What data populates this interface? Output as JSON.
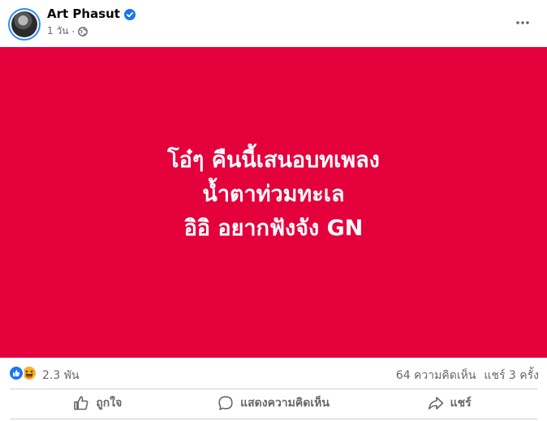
{
  "post": {
    "author": "Art Phasut",
    "time": "1 วัน",
    "separator": "·",
    "content_lines": [
      "โอ๋ๆ คืนนี้เสนอบทเพลง",
      "น้ำตาท่วมทะเล",
      "อิอิ อยากฟังจัง GN"
    ],
    "background_color": "#e4003b"
  },
  "stats": {
    "reaction_count": "2.3 พัน",
    "comments": "64 ความคิดเห็น",
    "shares": "แชร์ 3 ครั้ง",
    "reaction_types": [
      "like",
      "haha"
    ]
  },
  "actions": {
    "like_label": "ถูกใจ",
    "comment_label": "แสดงความคิดเห็น",
    "share_label": "แชร์"
  },
  "icons": [
    "verified-badge-icon",
    "globe-icon",
    "more-options-icon",
    "like-reaction-icon",
    "haha-reaction-icon",
    "thumbs-up-icon",
    "comment-bubble-icon",
    "share-arrow-icon"
  ],
  "colors": {
    "accent": "#1877f2",
    "secondary_text": "#65676b"
  }
}
